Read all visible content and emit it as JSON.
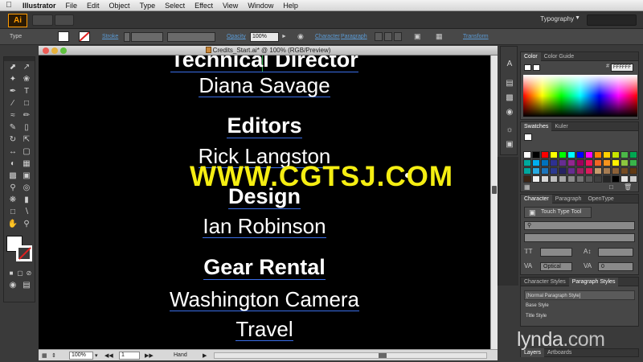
{
  "menubar": {
    "app_name": "Illustrator",
    "items": [
      "File",
      "Edit",
      "Object",
      "Type",
      "Select",
      "Effect",
      "View",
      "Window",
      "Help"
    ]
  },
  "appbar": {
    "logo": "Ai",
    "workspace": "Typography"
  },
  "controlbar": {
    "selection_label": "Type",
    "stroke_label": "Stroke",
    "opacity_label": "Opacity",
    "opacity_value": "100%",
    "character_link": "Character",
    "paragraph_link": "Paragraph",
    "transform_link": "Transform"
  },
  "document": {
    "title": "Credits_Start.ai* @ 100% (RGB/Preview)",
    "credits": [
      {
        "text": "Technical Director",
        "kind": "head"
      },
      {
        "text": "Diana Savage",
        "kind": "name"
      },
      {
        "text": "Editors",
        "kind": "head"
      },
      {
        "text": "Rick Langston",
        "kind": "name"
      },
      {
        "text": "Design",
        "kind": "head"
      },
      {
        "text": "Ian Robinson",
        "kind": "name"
      },
      {
        "text": "Gear Rental",
        "kind": "head"
      },
      {
        "text": "Washington Camera",
        "kind": "name"
      },
      {
        "text": "Travel",
        "kind": "name"
      }
    ]
  },
  "statusbar": {
    "zoom": "100%",
    "page": "1",
    "tool": "Hand"
  },
  "watermark": "WWW.CGTSJ.COM",
  "panels": {
    "color": {
      "tabs": [
        "Color",
        "Color Guide"
      ],
      "hex": "FFFFFF"
    },
    "swatches": {
      "tabs": [
        "Swatches",
        "Kuler"
      ],
      "colors": [
        "#ffffff",
        "#000000",
        "#ff0000",
        "#ffff00",
        "#00ff00",
        "#00ffff",
        "#0000ff",
        "#ff00ff",
        "#ff7f00",
        "#ffd200",
        "#c8e600",
        "#4cb848",
        "#00a651",
        "#00a99d",
        "#00aeef",
        "#0072bc",
        "#2e3192",
        "#662d91",
        "#92278f",
        "#9e005d",
        "#ed145b",
        "#f26522",
        "#f7941d",
        "#fff200",
        "#8dc63f",
        "#39b54a",
        "#00a79d",
        "#27aae1",
        "#1c75bc",
        "#2b3990",
        "#262262",
        "#652d90",
        "#9e1f63",
        "#da1c5c",
        "#c69c6d",
        "#a67c52",
        "#8c6239",
        "#754c24",
        "#603913",
        "#3c2415",
        "#f0f0f0",
        "#d9d9d9",
        "#bfbfbf",
        "#a6a6a6",
        "#8c8c8c",
        "#737373",
        "#595959",
        "#404040",
        "#262626",
        "#000000",
        "#e6e6e6",
        "#cccccc"
      ]
    },
    "character": {
      "tabs": [
        "Character",
        "Paragraph",
        "OpenType"
      ],
      "touch_tool": "Touch Type Tool",
      "font_size": "",
      "kerning": "Optical",
      "tracking": "0"
    },
    "paragraph_styles": {
      "tabs": [
        "Character Styles",
        "Paragraph Styles"
      ],
      "styles": [
        "[Normal Paragraph Style]",
        "Base Style",
        "Title Style"
      ]
    },
    "layers": {
      "tabs": [
        "Layers",
        "Artboards"
      ]
    }
  },
  "branding": {
    "lynda": "lynda",
    "dotcom": ".com"
  }
}
